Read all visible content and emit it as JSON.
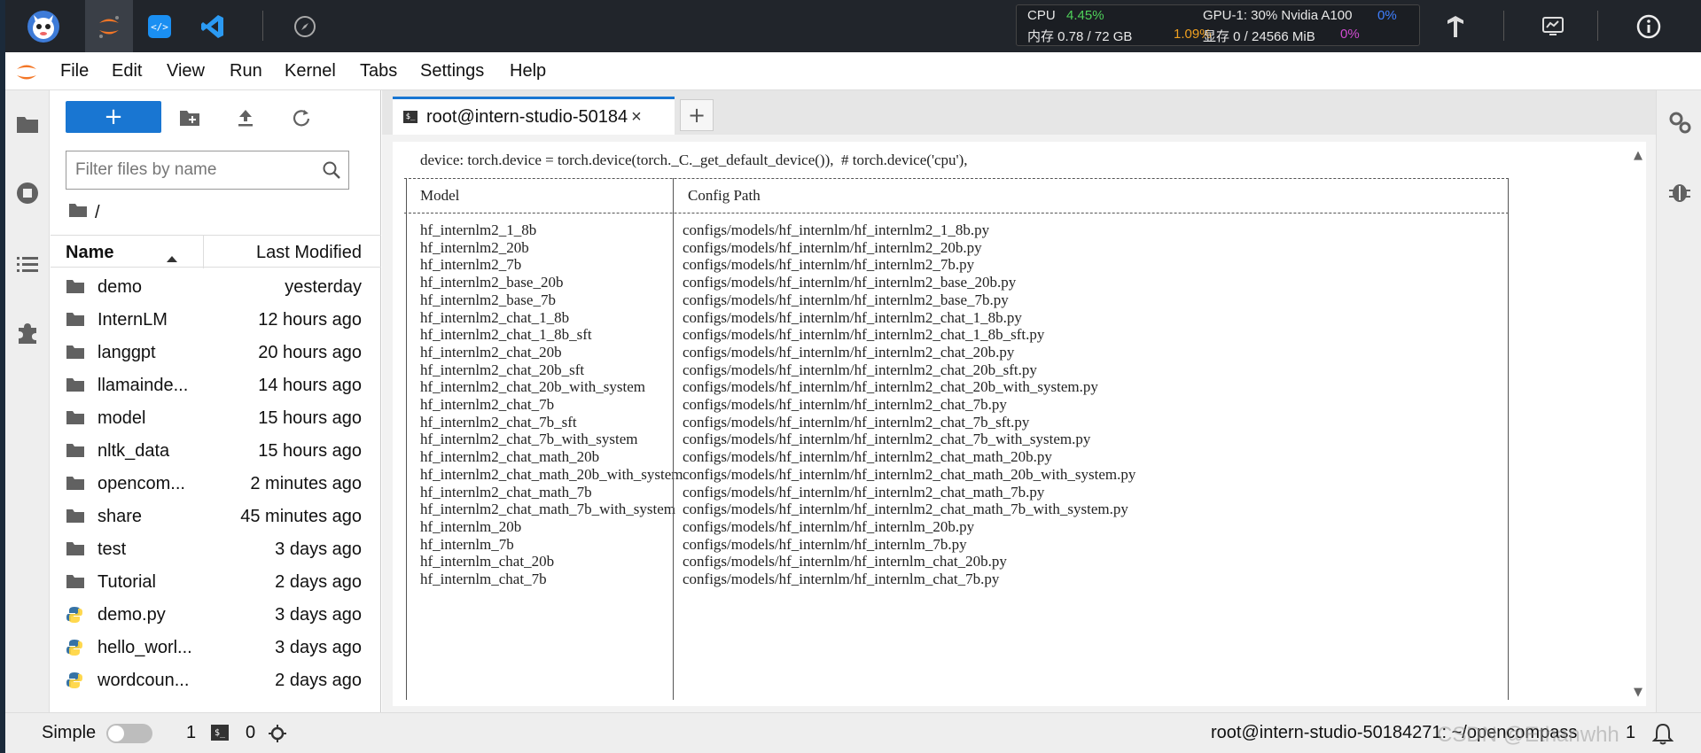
{
  "topbar": {
    "resources": {
      "cpu_label": "CPU",
      "cpu_value": "4.45%",
      "mem_label": "内存 0.78 / 72 GB",
      "mem_value": "1.09%",
      "gpu_label": "GPU-1: 30% Nvidia A100",
      "gpu_value": "0%",
      "vram_label": "显存 0 / 24566 MiB",
      "vram_value": "0%"
    },
    "icons": [
      "intern-mascot-logo",
      "jupyter-logo",
      "code-server-logo",
      "vscode-logo",
      "compass-icon",
      "tensorboard-icon",
      "monitor-icon",
      "info-icon"
    ]
  },
  "menubar": {
    "items": [
      "File",
      "Edit",
      "View",
      "Run",
      "Kernel",
      "Tabs",
      "Settings",
      "Help"
    ]
  },
  "filebrowser": {
    "new_label": "+",
    "filter_placeholder": "Filter files by name",
    "breadcrumb": "/",
    "col_name": "Name",
    "col_modified": "Last Modified",
    "files": [
      {
        "name": "demo",
        "modified": "yesterday",
        "type": "folder"
      },
      {
        "name": "InternLM",
        "modified": "12 hours ago",
        "type": "folder"
      },
      {
        "name": "langgpt",
        "modified": "20 hours ago",
        "type": "folder"
      },
      {
        "name": "llamainde...",
        "modified": "14 hours ago",
        "type": "folder"
      },
      {
        "name": "model",
        "modified": "15 hours ago",
        "type": "folder"
      },
      {
        "name": "nltk_data",
        "modified": "15 hours ago",
        "type": "folder"
      },
      {
        "name": "opencom...",
        "modified": "2 minutes ago",
        "type": "folder"
      },
      {
        "name": "share",
        "modified": "45 minutes ago",
        "type": "folder"
      },
      {
        "name": "test",
        "modified": "3 days ago",
        "type": "folder"
      },
      {
        "name": "Tutorial",
        "modified": "2 days ago",
        "type": "folder"
      },
      {
        "name": "demo.py",
        "modified": "3 days ago",
        "type": "python"
      },
      {
        "name": "hello_worl...",
        "modified": "3 days ago",
        "type": "python"
      },
      {
        "name": "wordcoun...",
        "modified": "2 days ago",
        "type": "python"
      }
    ]
  },
  "tab": {
    "title": "root@intern-studio-50184",
    "close": "×",
    "add": "+"
  },
  "terminal": {
    "first_line": "device: torch.device = torch.device(torch._C._get_default_device()),  # torch.device('cpu'),",
    "header_model": "Model",
    "header_config": "Config Path",
    "rows": [
      [
        "hf_internlm2_1_8b",
        "configs/models/hf_internlm/hf_internlm2_1_8b.py"
      ],
      [
        "hf_internlm2_20b",
        "configs/models/hf_internlm/hf_internlm2_20b.py"
      ],
      [
        "hf_internlm2_7b",
        "configs/models/hf_internlm/hf_internlm2_7b.py"
      ],
      [
        "hf_internlm2_base_20b",
        "configs/models/hf_internlm/hf_internlm2_base_20b.py"
      ],
      [
        "hf_internlm2_base_7b",
        "configs/models/hf_internlm/hf_internlm2_base_7b.py"
      ],
      [
        "hf_internlm2_chat_1_8b",
        "configs/models/hf_internlm/hf_internlm2_chat_1_8b.py"
      ],
      [
        "hf_internlm2_chat_1_8b_sft",
        "configs/models/hf_internlm/hf_internlm2_chat_1_8b_sft.py"
      ],
      [
        "hf_internlm2_chat_20b",
        "configs/models/hf_internlm/hf_internlm2_chat_20b.py"
      ],
      [
        "hf_internlm2_chat_20b_sft",
        "configs/models/hf_internlm/hf_internlm2_chat_20b_sft.py"
      ],
      [
        "hf_internlm2_chat_20b_with_system",
        "configs/models/hf_internlm/hf_internlm2_chat_20b_with_system.py"
      ],
      [
        "hf_internlm2_chat_7b",
        "configs/models/hf_internlm/hf_internlm2_chat_7b.py"
      ],
      [
        "hf_internlm2_chat_7b_sft",
        "configs/models/hf_internlm/hf_internlm2_chat_7b_sft.py"
      ],
      [
        "hf_internlm2_chat_7b_with_system",
        "configs/models/hf_internlm/hf_internlm2_chat_7b_with_system.py"
      ],
      [
        "hf_internlm2_chat_math_20b",
        "configs/models/hf_internlm/hf_internlm2_chat_math_20b.py"
      ],
      [
        "hf_internlm2_chat_math_20b_with_system",
        "configs/models/hf_internlm/hf_internlm2_chat_math_20b_with_system.py"
      ],
      [
        "hf_internlm2_chat_math_7b",
        "configs/models/hf_internlm/hf_internlm2_chat_math_7b.py"
      ],
      [
        "hf_internlm2_chat_math_7b_with_system",
        "configs/models/hf_internlm/hf_internlm2_chat_math_7b_with_system.py"
      ],
      [
        "hf_internlm_20b",
        "configs/models/hf_internlm/hf_internlm_20b.py"
      ],
      [
        "hf_internlm_7b",
        "configs/models/hf_internlm/hf_internlm_7b.py"
      ],
      [
        "hf_internlm_chat_20b",
        "configs/models/hf_internlm/hf_internlm_chat_20b.py"
      ],
      [
        "hf_internlm_chat_7b",
        "configs/models/hf_internlm/hf_internlm_chat_7b.py"
      ]
    ]
  },
  "statusbar": {
    "mode_label": "Simple",
    "count_terminals": "1",
    "count_kernels": "0",
    "terminal_path": "root@intern-studio-50184271: ~/opencompass",
    "right_count": "1",
    "watermark": "CSDN @Ethanwhh"
  },
  "colors": {
    "accent": "#1976d2",
    "topbar_bg": "#21252b",
    "jupyter_orange": "#f37626",
    "python_blue": "#3572a5",
    "python_yellow": "#ffd43b"
  }
}
